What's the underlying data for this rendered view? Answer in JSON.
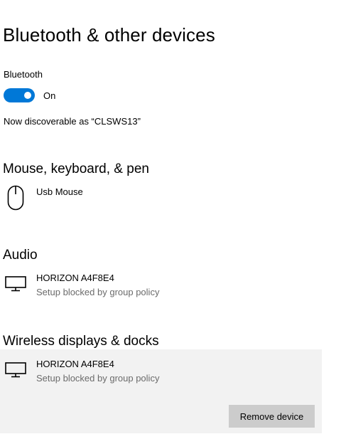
{
  "page": {
    "title": "Bluetooth & other devices"
  },
  "bluetooth": {
    "label": "Bluetooth",
    "toggle_state": "On",
    "enabled": true,
    "accent_color": "#0078d7",
    "discoverable_text": "Now discoverable as “CLSWS13”"
  },
  "sections": {
    "mouse": {
      "title": "Mouse, keyboard, & pen",
      "devices": [
        {
          "name": "Usb Mouse",
          "icon": "mouse-icon"
        }
      ]
    },
    "audio": {
      "title": "Audio",
      "devices": [
        {
          "name": "HORIZON A4F8E4",
          "status": "Setup blocked by group policy",
          "icon": "monitor-icon"
        }
      ]
    },
    "wireless": {
      "title": "Wireless displays & docks",
      "devices": [
        {
          "name": "HORIZON A4F8E4",
          "status": "Setup blocked by group policy",
          "icon": "monitor-icon",
          "selected": true,
          "action_label": "Remove device"
        }
      ]
    }
  }
}
